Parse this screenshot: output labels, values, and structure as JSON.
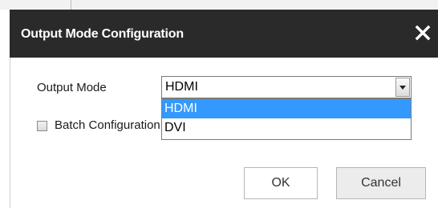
{
  "dialog": {
    "title": "Output Mode Configuration",
    "close_icon": "close-x-icon"
  },
  "form": {
    "output_mode_label": "Output Mode",
    "output_mode_value": "HDMI",
    "dropdown_arrow_icon": "chevron-down-icon",
    "options": [
      "HDMI",
      "DVI"
    ],
    "highlighted_option": "HDMI",
    "batch_label": "Batch Configuration",
    "batch_checked": false
  },
  "buttons": {
    "ok": "OK",
    "cancel": "Cancel"
  },
  "colors": {
    "titlebar": "#2a2a2a",
    "highlight": "#3399ff"
  }
}
